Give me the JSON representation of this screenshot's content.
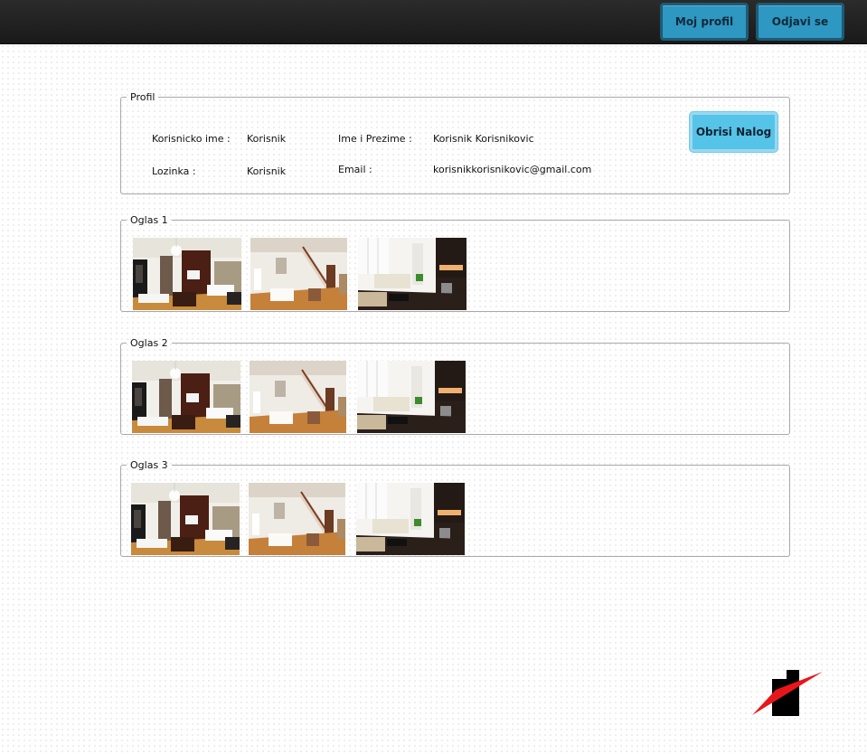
{
  "header": {
    "profile_button": "Moj profil",
    "logout_button": "Odjavi se"
  },
  "profile": {
    "legend": "Profil",
    "username_label": "Korisnicko ime :",
    "username_value": "Korisnik",
    "password_label": "Lozinka :",
    "password_value": "Korisnik",
    "fullname_label": "Ime i Prezime :",
    "fullname_value": "Korisnik Korisnikovic",
    "email_label": "Email :",
    "email_value": "korisnikkorisnikovic@gmail.com",
    "delete_button": "Obrisi Nalog"
  },
  "ads": [
    {
      "legend": "Oglas 1",
      "images": [
        "living-room-photo",
        "staircase-room-photo",
        "kitchen-photo"
      ]
    },
    {
      "legend": "Oglas 2",
      "images": [
        "living-room-photo",
        "staircase-room-photo",
        "kitchen-photo"
      ]
    },
    {
      "legend": "Oglas 3",
      "images": [
        "living-room-photo",
        "staircase-room-photo",
        "kitchen-photo"
      ]
    }
  ],
  "colors": {
    "topbar": "#1f1f1f",
    "button_blue": "#2e97c2",
    "delete_button": "#56c3e8",
    "logo_red": "#e8161b"
  }
}
